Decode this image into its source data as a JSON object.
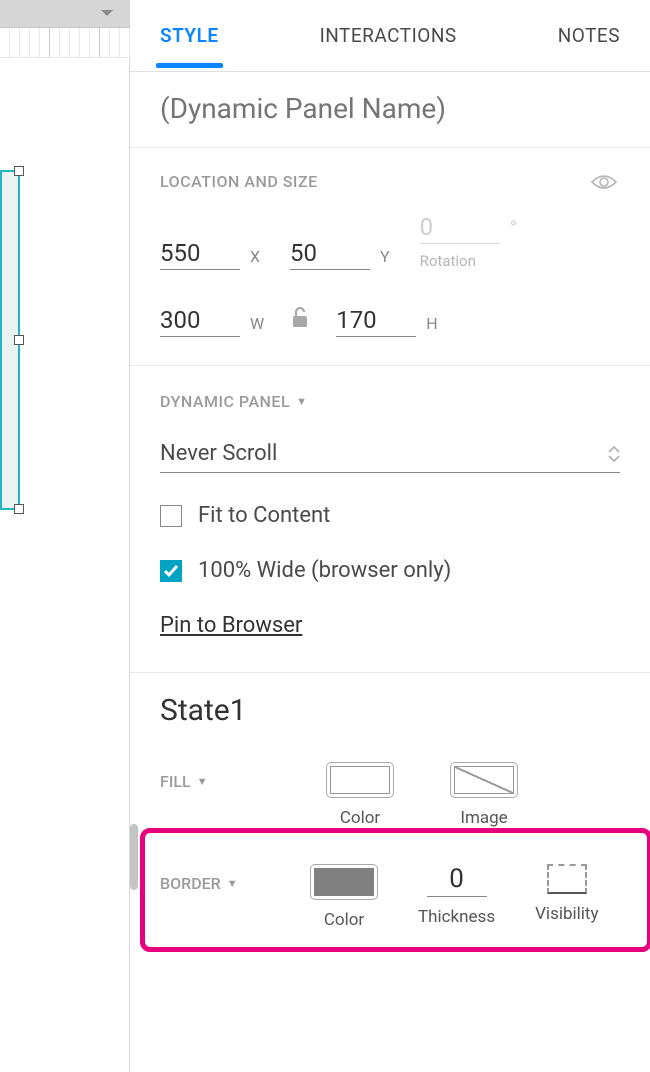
{
  "tabs": {
    "style": "STYLE",
    "interactions": "INTERACTIONS",
    "notes": "NOTES"
  },
  "name_placeholder": "(Dynamic Panel Name)",
  "location_size": {
    "label": "LOCATION AND SIZE",
    "x": "550",
    "x_unit": "X",
    "y": "50",
    "y_unit": "Y",
    "rotation": "0",
    "rotation_label": "Rotation",
    "w": "300",
    "w_unit": "W",
    "h": "170",
    "h_unit": "H"
  },
  "dynamic_panel": {
    "label": "DYNAMIC PANEL",
    "scroll_value": "Never Scroll",
    "fit_label": "Fit to Content",
    "fit_checked": false,
    "wide_label": "100% Wide (browser only)",
    "wide_checked": true,
    "pin_label": "Pin to Browser"
  },
  "state_title": "State1",
  "fill": {
    "label": "FILL",
    "color_caption": "Color",
    "image_caption": "Image"
  },
  "border": {
    "label": "BORDER",
    "color_caption": "Color",
    "thickness_value": "0",
    "thickness_caption": "Thickness",
    "visibility_caption": "Visibility"
  }
}
